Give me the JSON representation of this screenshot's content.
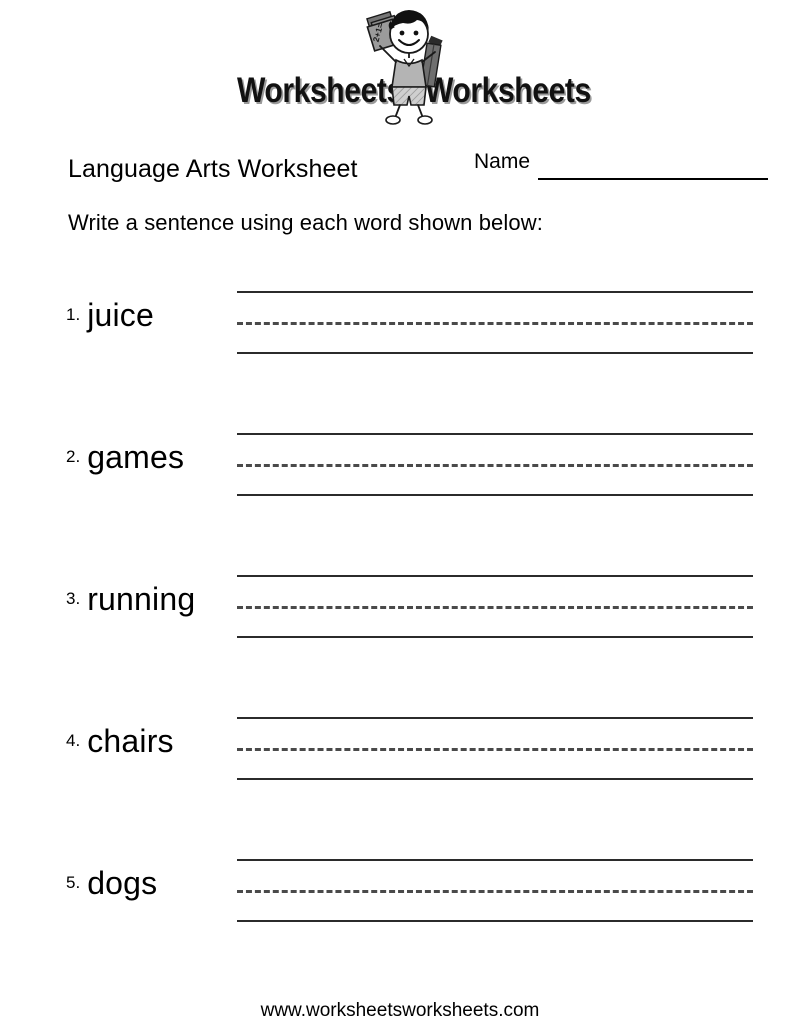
{
  "logo": {
    "word_left": "Worksheets",
    "word_right": "Worksheets",
    "book_text": "2+1="
  },
  "header": {
    "title": "Language Arts Worksheet",
    "name_label": "Name",
    "name_value": ""
  },
  "instructions": "Write a sentence using each word shown below:",
  "items": [
    {
      "number": "1.",
      "word": "juice"
    },
    {
      "number": "2.",
      "word": "games"
    },
    {
      "number": "3.",
      "word": "running"
    },
    {
      "number": "4.",
      "word": "chairs"
    },
    {
      "number": "5.",
      "word": "dogs"
    }
  ],
  "footer": {
    "url": "www.worksheetsworksheets.com"
  },
  "colors": {
    "ink": "#000000",
    "rule": "#2b2b2b",
    "dash": "#4a4a4a",
    "logo_shadow": "#9a9a9a",
    "page": "#ffffff"
  }
}
